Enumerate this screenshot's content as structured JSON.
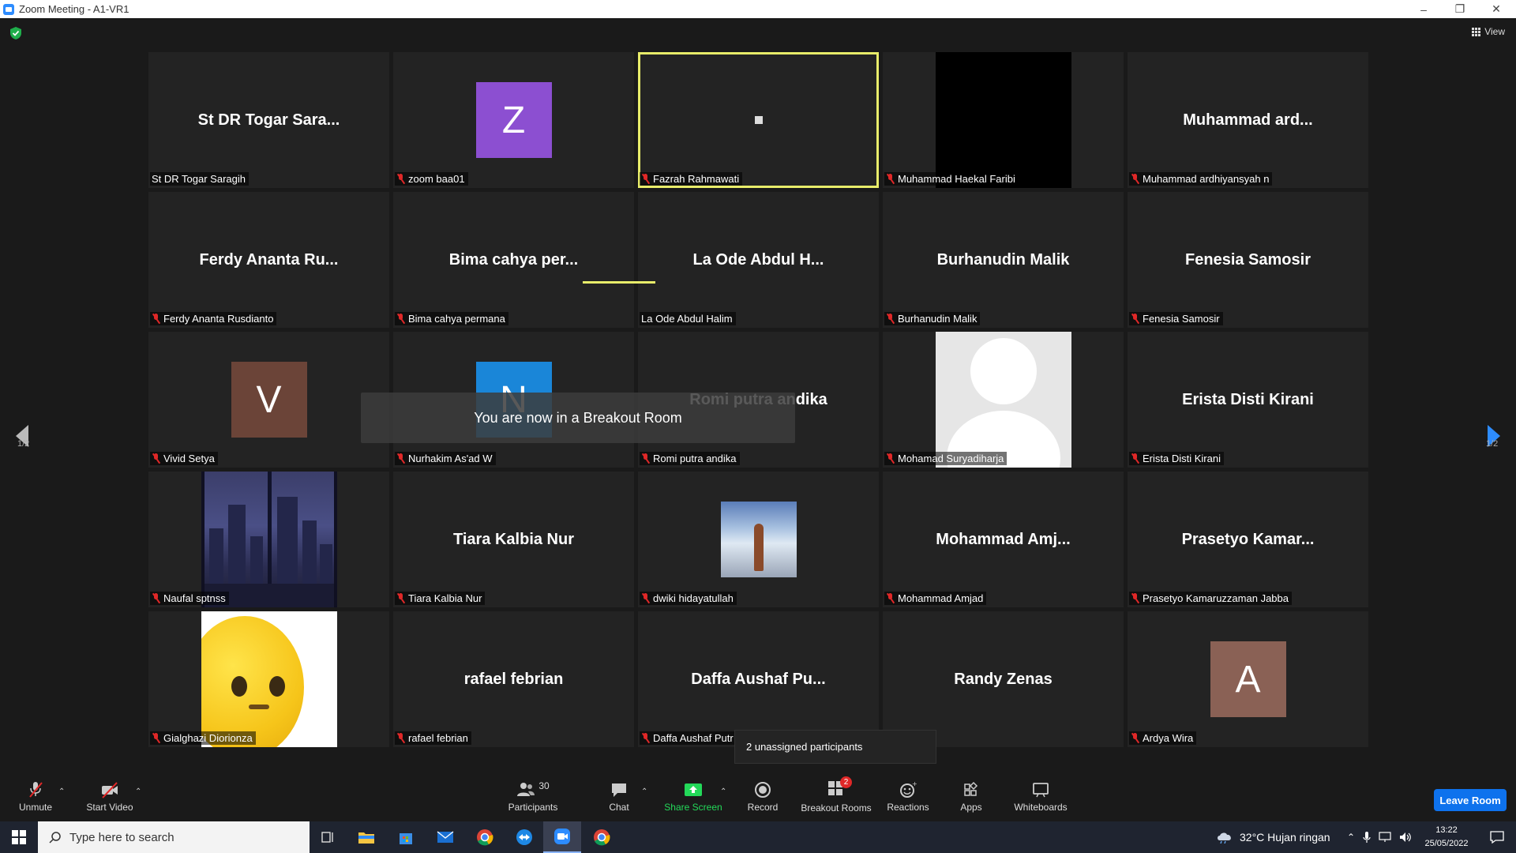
{
  "window": {
    "title": "Zoom Meeting - A1-VR1"
  },
  "top_bar": {
    "view_label": "View"
  },
  "tiles": [
    {
      "big": "St DR Togar Sara...",
      "label": "St DR Togar Saragih",
      "muted": false,
      "kind": "name"
    },
    {
      "big": "",
      "label": "zoom baa01",
      "muted": true,
      "kind": "avatar",
      "letter": "Z",
      "color": "#8c4fd1"
    },
    {
      "big": "",
      "label": "Fazrah Rahmawati",
      "muted": true,
      "kind": "dot",
      "active": true
    },
    {
      "big": "",
      "label": "Muhammad Haekal Faribi",
      "muted": true,
      "kind": "black"
    },
    {
      "big": "Muhammad ard...",
      "label": "Muhammad ardhiyansyah n",
      "muted": true,
      "kind": "name"
    },
    {
      "big": "Ferdy Ananta Ru...",
      "label": "Ferdy Ananta Rusdianto",
      "muted": true,
      "kind": "name"
    },
    {
      "big": "Bima cahya per...",
      "label": "Bima cahya permana",
      "muted": true,
      "kind": "name"
    },
    {
      "big": "La Ode Abdul H...",
      "label": "La Ode Abdul Halim",
      "muted": false,
      "kind": "name"
    },
    {
      "big": "Burhanudin Malik",
      "label": "Burhanudin Malik",
      "muted": true,
      "kind": "name"
    },
    {
      "big": "Fenesia Samosir",
      "label": "Fenesia Samosir",
      "muted": true,
      "kind": "name"
    },
    {
      "big": "",
      "label": "Vivid Setya",
      "muted": true,
      "kind": "avatar",
      "letter": "V",
      "color": "#6b4438"
    },
    {
      "big": "",
      "label": "Nurhakim As'ad W",
      "muted": true,
      "kind": "avatar",
      "letter": "N",
      "color": "#1a86d8"
    },
    {
      "big": "Romi putra andika",
      "label": "Romi putra andika",
      "muted": true,
      "kind": "name"
    },
    {
      "big": "",
      "label": "Mohamad Suryadiharja",
      "muted": true,
      "kind": "grey"
    },
    {
      "big": "Erista Disti Kirani",
      "label": "Erista Disti Kirani",
      "muted": true,
      "kind": "name"
    },
    {
      "big": "",
      "label": "Naufal sptnss",
      "muted": true,
      "kind": "city"
    },
    {
      "big": "Tiara Kalbia Nur",
      "label": "Tiara Kalbia Nur",
      "muted": true,
      "kind": "name"
    },
    {
      "big": "",
      "label": "dwiki hidayatullah",
      "muted": true,
      "kind": "photo"
    },
    {
      "big": "Mohammad  Amj...",
      "label": "Mohammad Amjad",
      "muted": true,
      "kind": "name"
    },
    {
      "big": "Prasetyo Kamar...",
      "label": "Prasetyo Kamaruzzaman Jabba",
      "muted": true,
      "kind": "name"
    },
    {
      "big": "",
      "label": "Gialghazi Diorionza",
      "muted": true,
      "kind": "emoji"
    },
    {
      "big": "rafael febrian",
      "label": "rafael febrian",
      "muted": true,
      "kind": "name"
    },
    {
      "big": "Daffa Aushaf Pu...",
      "label": "Daffa Aushaf Putr",
      "muted": true,
      "kind": "name"
    },
    {
      "big": "Randy Zenas",
      "label": "enas",
      "muted": false,
      "kind": "name"
    },
    {
      "big": "",
      "label": "Ardya Wira",
      "muted": true,
      "kind": "avatar",
      "letter": "A",
      "color": "#8a6155"
    }
  ],
  "toast": "You are now in a Breakout Room",
  "pager": {
    "left": "1/2",
    "right": "1/2"
  },
  "unassigned": "2 unassigned participants",
  "toolbar": {
    "unmute": "Unmute",
    "start_video": "Start Video",
    "participants": "Participants",
    "participants_count": "30",
    "chat": "Chat",
    "share_screen": "Share Screen",
    "record": "Record",
    "breakout_rooms": "Breakout Rooms",
    "breakout_badge": "2",
    "reactions": "Reactions",
    "apps": "Apps",
    "whiteboards": "Whiteboards",
    "leave": "Leave Room"
  },
  "taskbar": {
    "search_placeholder": "Type here to search",
    "weather": "32°C  Hujan ringan",
    "time": "13:22",
    "date": "25/05/2022"
  }
}
